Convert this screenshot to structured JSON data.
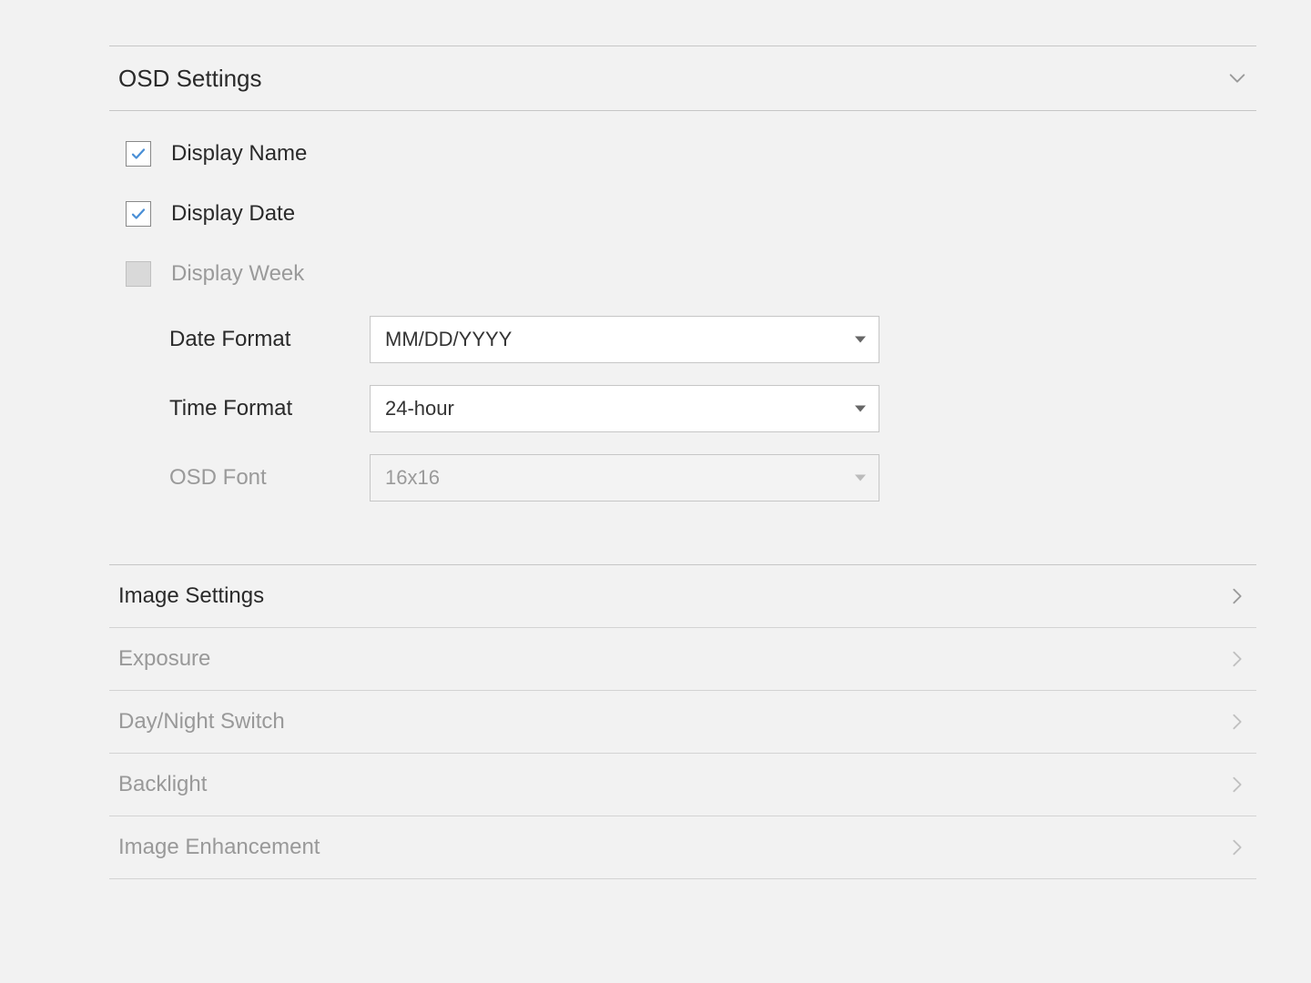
{
  "osd": {
    "title": "OSD Settings",
    "display_name": {
      "label": "Display Name"
    },
    "display_date": {
      "label": "Display Date"
    },
    "display_week": {
      "label": "Display Week"
    },
    "date_format": {
      "label": "Date Format",
      "value": "MM/DD/YYYY"
    },
    "time_format": {
      "label": "Time Format",
      "value": "24-hour"
    },
    "osd_font": {
      "label": "OSD Font",
      "value": "16x16"
    }
  },
  "sections": {
    "image_settings": {
      "label": "Image Settings"
    },
    "exposure": {
      "label": "Exposure"
    },
    "day_night_switch": {
      "label": "Day/Night Switch"
    },
    "backlight": {
      "label": "Backlight"
    },
    "image_enhancement": {
      "label": "Image Enhancement"
    }
  }
}
